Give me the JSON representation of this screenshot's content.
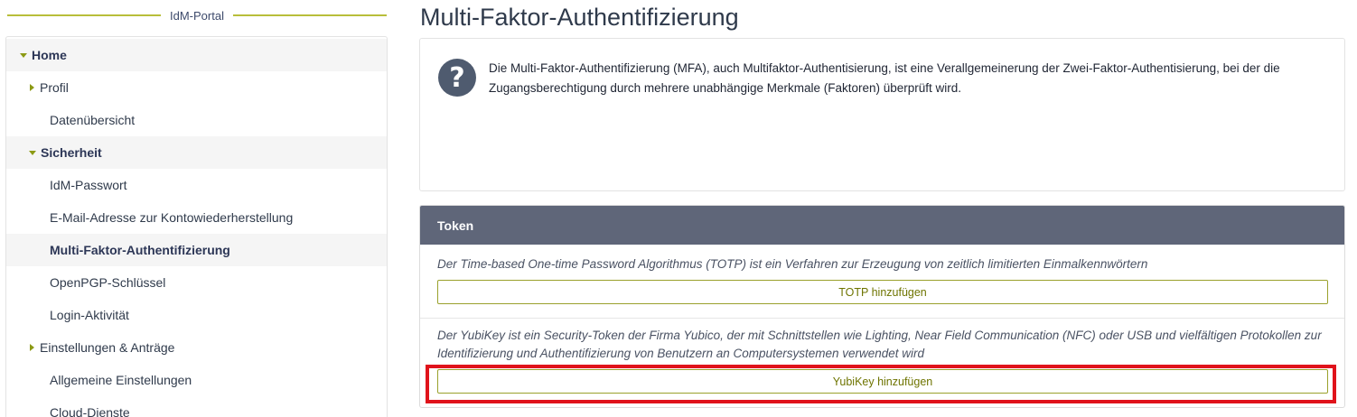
{
  "portal": {
    "title": "IdM-Portal"
  },
  "sidebar": {
    "items": [
      {
        "label": "Home"
      },
      {
        "label": "Profil"
      },
      {
        "label": "Datenübersicht"
      },
      {
        "label": "Sicherheit"
      },
      {
        "label": "IdM-Passwort"
      },
      {
        "label": "E-Mail-Adresse zur Kontowiederherstellung"
      },
      {
        "label": "Multi-Faktor-Authentifizierung"
      },
      {
        "label": "OpenPGP-Schlüssel"
      },
      {
        "label": "Login-Aktivität"
      },
      {
        "label": "Einstellungen & Anträge"
      },
      {
        "label": "Allgemeine Einstellungen"
      },
      {
        "label": "Cloud-Dienste"
      }
    ]
  },
  "main": {
    "title": "Multi-Faktor-Authentifizierung",
    "info": {
      "icon": "question-circle-icon",
      "text": "Die Multi-Faktor-Authentifizierung (MFA), auch Multifaktor-Authentisierung, ist eine Verallgemeinerung der Zwei-Faktor-Authentisierung, bei der die Zugangsberechtigung durch mehrere unabhängige Merkmale (Faktoren) überprüft wird."
    },
    "token": {
      "heading": "Token",
      "totp": {
        "description": "Der Time-based One-time Password Algorithmus (TOTP) ist ein Verfahren zur Erzeugung von zeitlich limitierten Einmalkennwörtern",
        "button": "TOTP hinzufügen"
      },
      "yubikey": {
        "description": "Der YubiKey ist ein Security-Token der Firma Yubico, der mit Schnittstellen wie Lighting, Near Field Communication (NFC) oder USB und vielfältigen Protokollen zur Identifizierung und Authentifizierung von Benutzern an Computersystemen verwendet wird",
        "button": "YubiKey hinzufügen"
      }
    }
  },
  "colors": {
    "accent": "#8c9a14",
    "header_bar": "#5f6679",
    "highlight": "#e0131b"
  }
}
